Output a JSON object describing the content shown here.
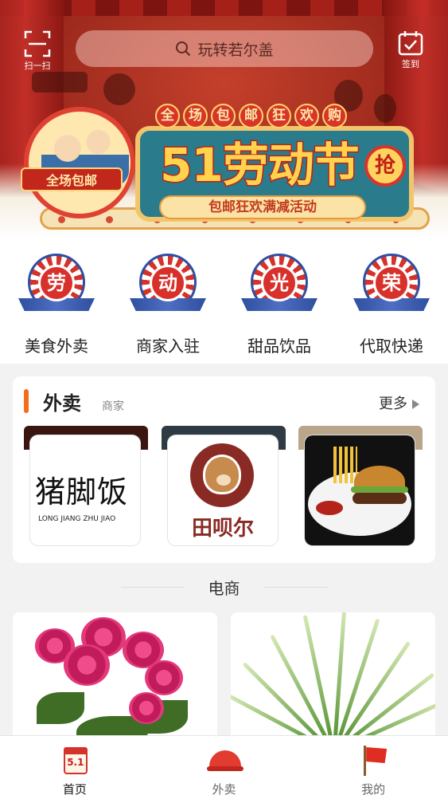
{
  "header": {
    "scan_label": "扫一扫",
    "search_placeholder": "玩转若尔盖",
    "sign_label": "签到"
  },
  "banner": {
    "top_characters": [
      "全",
      "场",
      "包",
      "邮",
      "狂",
      "欢",
      "购"
    ],
    "headline": "51劳动节",
    "subline": "包邮狂欢满减活动",
    "badge_ribbon": "全场包邮",
    "grab_label": "抢"
  },
  "categories": [
    {
      "glyph": "劳",
      "label": "美食外卖"
    },
    {
      "glyph": "动",
      "label": "商家入驻"
    },
    {
      "glyph": "光",
      "label": "甜品饮品"
    },
    {
      "glyph": "荣",
      "label": "代取快递"
    }
  ],
  "takeout": {
    "title": "外卖",
    "subtitle": "商家",
    "more_label": "更多",
    "shops": [
      {
        "logo_text": "猪脚饭",
        "logo_subtext": "LONG JIANG ZHU JIAO"
      },
      {
        "logo_text": "田呗尔"
      },
      {
        "image": "burger-plate"
      }
    ]
  },
  "ecommerce": {
    "title": "电商",
    "products": [
      {
        "image": "peony-flower"
      },
      {
        "image": "spider-plant"
      }
    ]
  },
  "tabbar": {
    "items": [
      {
        "label": "首页",
        "icon": "calendar-icon",
        "active": true,
        "icon_text": "5.1"
      },
      {
        "label": "外卖",
        "icon": "helmet-icon",
        "active": false
      },
      {
        "label": "我的",
        "icon": "flag-icon",
        "active": false
      }
    ]
  },
  "colors": {
    "accent": "#f56c1b",
    "brand_red": "#d5322a",
    "banner_teal": "#2a7c8c",
    "gold": "#ffd34d"
  }
}
